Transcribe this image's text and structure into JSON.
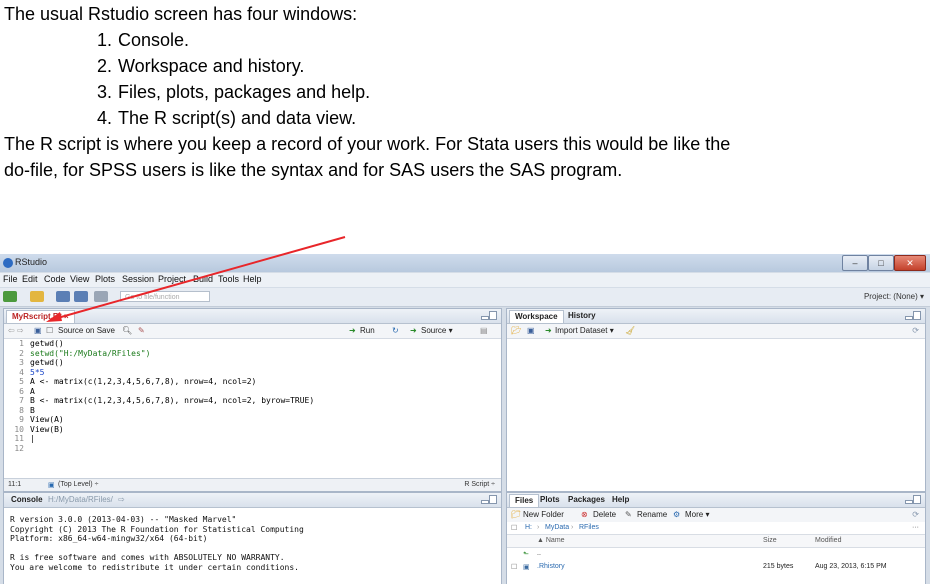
{
  "intro": {
    "line1": "The usual Rstudio screen has four windows:",
    "items": [
      {
        "num": "1.",
        "text": "Console."
      },
      {
        "num": "2.",
        "text": "Workspace and history."
      },
      {
        "num": "3.",
        "text": "Files, plots, packages and help."
      },
      {
        "num": "4.",
        "text": "The R script(s) and data view."
      }
    ],
    "para1": "The R script is where you keep a record of your work. For Stata users this would be like the",
    "para2": "do-file, for SPSS users is like the syntax and for SAS users the SAS program."
  },
  "window": {
    "title": "RStudio",
    "menus": [
      "File",
      "Edit",
      "Code",
      "View",
      "Plots",
      "Session",
      "Project",
      "Build",
      "Tools",
      "Help"
    ],
    "goto_placeholder": "Go to file/function",
    "project": "Project: (None) ▾"
  },
  "editor": {
    "tab": "MyRscript.R* ×",
    "source_on_save": "Source on Save",
    "run": "Run",
    "source": "Source ▾",
    "lines": [
      {
        "n": "1",
        "code": "getwd()"
      },
      {
        "n": "2",
        "code": "setwd(\"H:/MyData/RFiles\")"
      },
      {
        "n": "3",
        "code": "getwd()"
      },
      {
        "n": "4",
        "code": "5*5"
      },
      {
        "n": "5",
        "code": "A <- matrix(c(1,2,3,4,5,6,7,8), nrow=4, ncol=2)"
      },
      {
        "n": "6",
        "code": "A"
      },
      {
        "n": "7",
        "code": "B <- matrix(c(1,2,3,4,5,6,7,8), nrow=4, ncol=2, byrow=TRUE)"
      },
      {
        "n": "8",
        "code": "B"
      },
      {
        "n": "9",
        "code": "View(A)"
      },
      {
        "n": "10",
        "code": "View(B)"
      },
      {
        "n": "11",
        "code": "|"
      },
      {
        "n": "12",
        "code": ""
      }
    ],
    "status_pos": "11:1",
    "status_scope": "(Top Level) ÷",
    "status_type": "R Script ÷"
  },
  "workspace": {
    "tabs": [
      "Workspace",
      "History"
    ],
    "import": "Import Dataset ▾"
  },
  "console": {
    "title": "Console",
    "path": "H:/MyData/RFiles/",
    "lines": [
      "R version 3.0.0 (2013-04-03) -- \"Masked Marvel\"",
      "Copyright (C) 2013 The R Foundation for Statistical Computing",
      "Platform: x86_64-w64-mingw32/x64 (64-bit)",
      "",
      "R is free software and comes with ABSOLUTELY NO WARRANTY.",
      "You are welcome to redistribute it under certain conditions."
    ]
  },
  "files": {
    "tabs": [
      "Files",
      "Plots",
      "Packages",
      "Help"
    ],
    "new_folder": "New Folder",
    "delete": "Delete",
    "rename": "Rename",
    "more": "More ▾",
    "breadcrumb": [
      "H:",
      "MyData",
      "RFiles"
    ],
    "col_name": "▲ Name",
    "col_size": "Size",
    "col_modified": "Modified",
    "up": "..",
    "rows": [
      {
        "name": ".Rhistory",
        "size": "215 bytes",
        "modified": "Aug 23, 2013, 6:15 PM"
      }
    ]
  },
  "colors": {
    "arrow": "#e8262a",
    "accent": "#2d6bc2"
  }
}
